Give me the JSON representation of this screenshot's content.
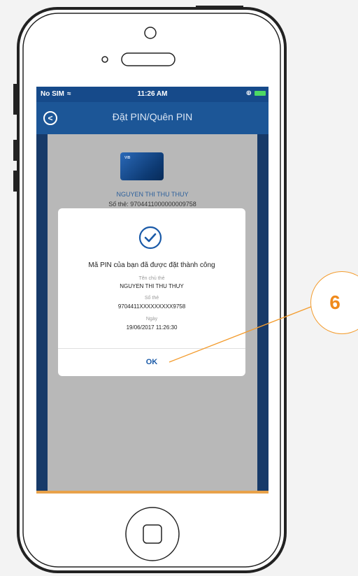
{
  "status_bar": {
    "carrier": "No SIM",
    "time": "11:26 AM"
  },
  "nav": {
    "title": "Đặt PIN/Quên PIN"
  },
  "background_card": {
    "holder_name": "NGUYEN THI THU THUY",
    "number_line": "Số thẻ: 9704411000000009758"
  },
  "dialog": {
    "message": "Mã PIN của bạn đã được đặt thành công",
    "card_holder_label": "Tên chủ thẻ",
    "card_holder_value": "NGUYEN THI THU THUY",
    "card_number_label": "Số thẻ",
    "card_number_value": "9704411XXXXXXXXX9758",
    "date_label": "Ngày",
    "date_value": "19/06/2017 11:26:30",
    "ok_label": "OK"
  },
  "callout": {
    "number": "6"
  },
  "colors": {
    "accent_orange": "#f08a1c",
    "nav_blue": "#1c5697",
    "link_blue": "#1a5aa8"
  }
}
